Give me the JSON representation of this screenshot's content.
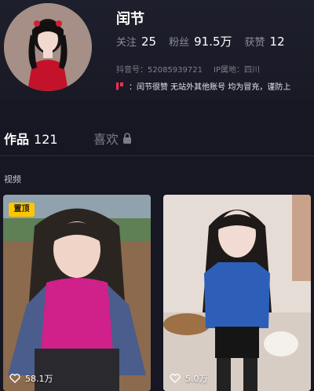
{
  "profile": {
    "nickname": "闰节",
    "stats": [
      {
        "label": "关注",
        "value": "25"
      },
      {
        "label": "粉丝",
        "value": "91.5万"
      },
      {
        "label": "获赞",
        "value": "12"
      }
    ],
    "douyin_id": "抖音号：52085939721",
    "ip_location": "IP属地：四川",
    "bio": "：闰节很赞 无站外其他账号 均为冒充，谨防上"
  },
  "tabs": {
    "works_label": "作品",
    "works_count": "121",
    "likes_label": "喜欢"
  },
  "section_label": "视频",
  "videos": [
    {
      "pinned_label": "置顶",
      "likes": "58.1万"
    },
    {
      "likes": "5.0万"
    }
  ],
  "colors": {
    "background": "#161722",
    "pin_badge": "#ffc500",
    "accent": "#ff2c55"
  },
  "icons": {
    "lock": "lock-icon",
    "like": "heart-outline-icon",
    "bio_flag": "flag-icon"
  }
}
